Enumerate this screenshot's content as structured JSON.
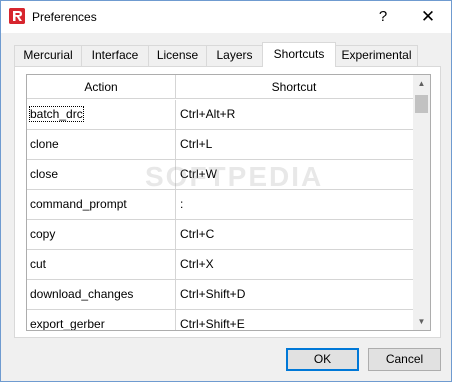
{
  "window": {
    "title": "Preferences",
    "help_glyph": "?",
    "close_glyph": "✕"
  },
  "tabs": [
    {
      "label": "Mercurial",
      "active": false
    },
    {
      "label": "Interface",
      "active": false
    },
    {
      "label": "License",
      "active": false
    },
    {
      "label": "Layers",
      "active": false
    },
    {
      "label": "Shortcuts",
      "active": true
    },
    {
      "label": "Experimental",
      "active": false
    }
  ],
  "table": {
    "columns": [
      "Action",
      "Shortcut"
    ],
    "rows": [
      {
        "action": "batch_drc",
        "shortcut": "Ctrl+Alt+R"
      },
      {
        "action": "clone",
        "shortcut": "Ctrl+L"
      },
      {
        "action": "close",
        "shortcut": "Ctrl+W"
      },
      {
        "action": "command_prompt",
        "shortcut": ":"
      },
      {
        "action": "copy",
        "shortcut": "Ctrl+C"
      },
      {
        "action": "cut",
        "shortcut": "Ctrl+X"
      },
      {
        "action": "download_changes",
        "shortcut": "Ctrl+Shift+D"
      },
      {
        "action": "export_gerber",
        "shortcut": "Ctrl+Shift+E"
      }
    ]
  },
  "watermark": "SOFTPEDIA",
  "buttons": {
    "ok": "OK",
    "cancel": "Cancel"
  },
  "icons": {
    "app": "app-logo-icon",
    "scroll_up": "▲",
    "scroll_down": "▼"
  }
}
